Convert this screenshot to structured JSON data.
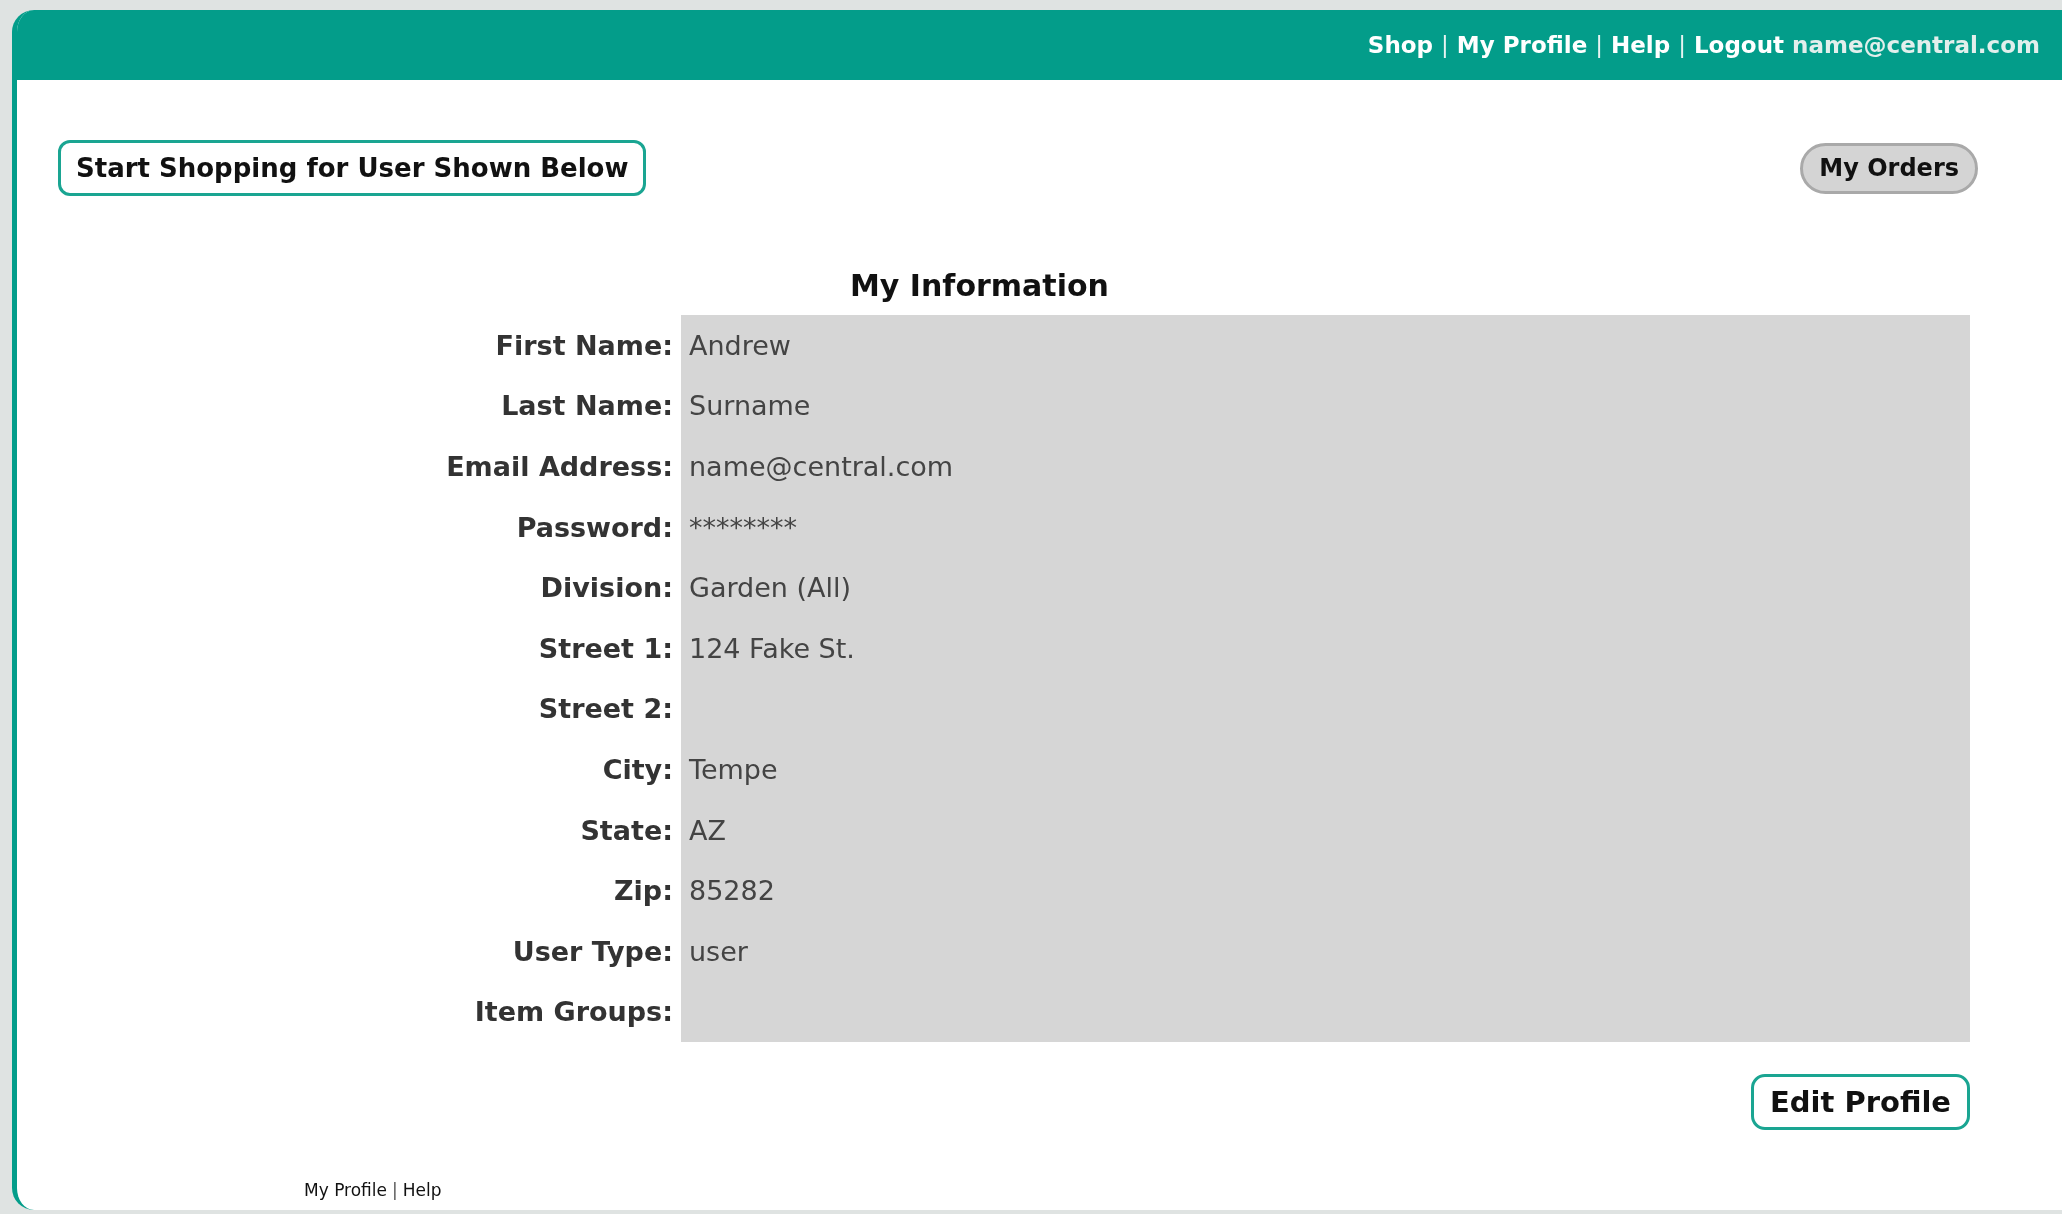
{
  "header_nav": [
    {
      "kind": "link",
      "text": "Shop"
    },
    {
      "kind": "separator",
      "text": "|"
    },
    {
      "kind": "link",
      "text": "My Profile"
    },
    {
      "kind": "separator",
      "text": "|"
    },
    {
      "kind": "link",
      "text": "Help"
    },
    {
      "kind": "separator",
      "text": "|"
    },
    {
      "kind": "link",
      "text": "Logout"
    },
    {
      "kind": "user",
      "text": "name@central.com"
    }
  ],
  "start_shopping_button": "Start Shopping for User Shown Below",
  "my_orders_button": "My Orders",
  "info": {
    "title": "My Information",
    "fields": [
      {
        "label": "First Name:",
        "value": "Andrew"
      },
      {
        "label": "Last Name:",
        "value": "Surname"
      },
      {
        "label": "Email Address:",
        "value": "name@central.com"
      },
      {
        "label": "Password:",
        "value": "********"
      },
      {
        "label": "Division:",
        "value": "Garden (All)"
      },
      {
        "label": "Street 1:",
        "value": "124 Fake St."
      },
      {
        "label": "Street 2:"
      },
      {
        "label": "City:",
        "value": "Tempe"
      },
      {
        "label": "State:",
        "value": "AZ"
      },
      {
        "label": "Zip:",
        "value": "85282"
      },
      {
        "label": "User Type:",
        "value": "user"
      },
      {
        "label": "Item Groups:"
      }
    ]
  },
  "edit_profile_button": "Edit Profile",
  "footer_nav": [
    {
      "kind": "link",
      "text": "My Profile"
    },
    {
      "kind": "separator",
      "text": "|"
    },
    {
      "kind": "link",
      "text": "Help"
    }
  ]
}
